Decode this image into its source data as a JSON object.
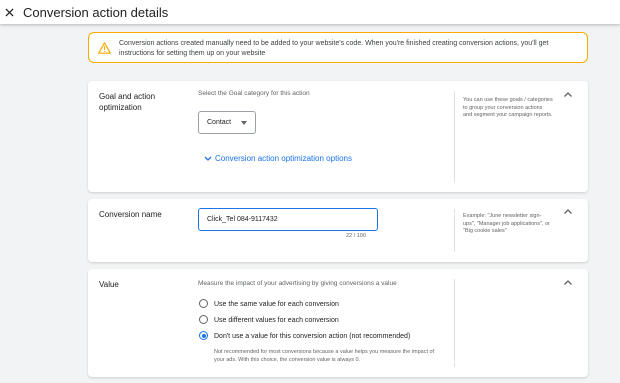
{
  "header": {
    "title": "Conversion action details",
    "close_icon": "close-icon"
  },
  "alert": {
    "icon": "warning-icon",
    "text": "Conversion actions created manually need to be added to your website's code. When you're finished creating conversion actions, you'll get instructions for setting them up on your website"
  },
  "goal": {
    "heading": "Goal and action optimization",
    "subtitle": "Select the Goal category for this action",
    "select_value": "Contact",
    "link_label": "Conversion action optimization options",
    "help": "You can use these goals / categories to group your conversion actions and segment your campaign reports."
  },
  "name": {
    "heading": "Conversion name",
    "value": "Click_Tel 084-9117432",
    "counter": "22 / 100",
    "help": "Example: \"June newsletter sign-ups\", \"Manager job applications\", or \"Big cookie sales\""
  },
  "value": {
    "heading": "Value",
    "subtitle": "Measure the impact of your advertising by giving conversions a value",
    "options": [
      {
        "label": "Use the same value for each conversion",
        "selected": false
      },
      {
        "label": "Use different values for each conversion",
        "selected": false
      },
      {
        "label": "Don't use a value for this conversion action (not recommended)",
        "selected": true
      }
    ],
    "selected_description": "Not recommended for most conversions because a value helps you measure the impact of your ads. With this choice, the conversion value is always 0."
  },
  "colors": {
    "accent": "#1a73e8",
    "warning": "#f9ab00"
  }
}
